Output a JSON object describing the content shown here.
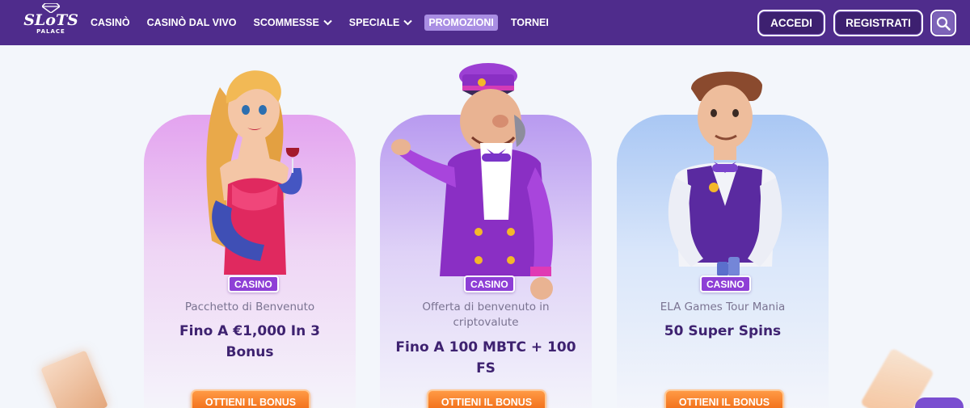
{
  "header": {
    "logo": {
      "word": "SLoTS",
      "sub": "PALACE"
    },
    "nav": [
      {
        "label": "CASINÒ"
      },
      {
        "label": "CASINÒ DAL VIVO"
      },
      {
        "label": "SCOMMESSE"
      },
      {
        "label": "SPECIALE"
      },
      {
        "label": "PROMOZIONI"
      },
      {
        "label": "TORNEI"
      }
    ],
    "login_label": "ACCEDI",
    "register_label": "REGISTRATI"
  },
  "promos": [
    {
      "badge": "CASINO",
      "subtitle": "Pacchetto di Benvenuto",
      "headline_line1": "Fino A €1,000 In 3",
      "headline_line2": "Bonus",
      "cta": "OTTIENI IL BONUS"
    },
    {
      "badge": "CASINO",
      "subtitle_line1": "Offerta di benvenuto in",
      "subtitle_line2": "criptovalute",
      "headline_line1": "Fino A 100 MBTC + 100",
      "headline_line2": "FS",
      "cta": "OTTIENI IL BONUS"
    },
    {
      "badge": "CASINO",
      "subtitle": "ELA Games Tour Mania",
      "headline_line1": "50 Super Spins",
      "cta": "OTTIENI IL BONUS"
    }
  ],
  "colors": {
    "header_bg": "#4f2c8c",
    "badge_bg": "#8e3fd6",
    "headline": "#3e2270",
    "cta": "#f06a14"
  },
  "icons": [
    "logo-gem-icon",
    "chevron-down-icon",
    "search-icon"
  ]
}
